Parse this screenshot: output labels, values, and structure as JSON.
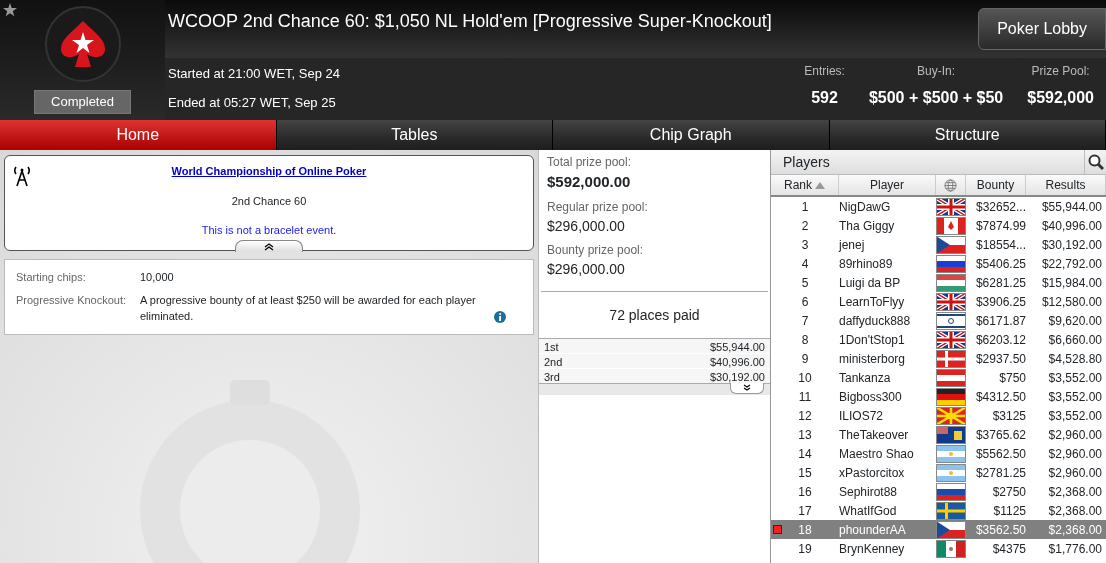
{
  "header": {
    "status": "Completed",
    "title": "WCOOP 2nd Chance 60: $1,050 NL Hold'em [Progressive Super-Knockout]",
    "started": "Started at 21:00 WET, Sep 24",
    "ended": "Ended at 05:27 WET, Sep 25",
    "lobby_button": "Poker Lobby",
    "stats": [
      {
        "label": "Entries:",
        "value": "592"
      },
      {
        "label": "Buy-In:",
        "value": "$500 + $500 + $50"
      },
      {
        "label": "Prize Pool:",
        "value": "$592,000"
      }
    ]
  },
  "tabs": [
    {
      "label": "Home",
      "selected": true
    },
    {
      "label": "Tables",
      "selected": false
    },
    {
      "label": "Chip Graph",
      "selected": false
    },
    {
      "label": "Structure",
      "selected": false
    }
  ],
  "info": {
    "link": "World Championship of Online Poker",
    "event": "2nd Chance 60",
    "note": "This is not a bracelet event."
  },
  "details": [
    {
      "label": "Starting chips:",
      "value": "10,000"
    },
    {
      "label": "Progressive Knockout:",
      "value": "A progressive bounty of at least $250 will be awarded for each player eliminated."
    }
  ],
  "prizes": {
    "pools": [
      {
        "label": "Total prize pool:",
        "value": "$592,000.00"
      },
      {
        "label": "Regular prize pool:",
        "value": "$296,000.00"
      },
      {
        "label": "Bounty prize pool:",
        "value": "$296,000.00"
      }
    ],
    "places": "72 places paid",
    "payouts": [
      {
        "place": "1st",
        "amount": "$55,944.00"
      },
      {
        "place": "2nd",
        "amount": "$40,996.00"
      },
      {
        "place": "3rd",
        "amount": "$30,192.00"
      }
    ]
  },
  "players": {
    "title": "Players",
    "columns": [
      "Rank",
      "Player",
      "Bounty",
      "Results"
    ],
    "rows": [
      {
        "rank": "1",
        "name": "NigDawG",
        "kind": "uk",
        "bounty": "$32652...",
        "result": "$55,944.00",
        "selected": false
      },
      {
        "rank": "2",
        "name": "Tha Giggy",
        "kind": "canada",
        "bounty": "$7874.99",
        "result": "$40,996.00",
        "selected": false
      },
      {
        "rank": "3",
        "name": "jenej",
        "kind": "czech",
        "bounty": "$18554...",
        "result": "$30,192.00",
        "selected": false
      },
      {
        "rank": "4",
        "name": "89rhino89",
        "kind": "russia",
        "bounty": "$5406.25",
        "result": "$22,792.00",
        "selected": false
      },
      {
        "rank": "5",
        "name": "Luigi da BP",
        "kind": "hungary",
        "bounty": "$6281.25",
        "result": "$15,984.00",
        "selected": false
      },
      {
        "rank": "6",
        "name": "LearnToFlyy",
        "kind": "uk",
        "bounty": "$3906.25",
        "result": "$12,580.00",
        "selected": false
      },
      {
        "rank": "7",
        "name": "daffyduck888",
        "kind": "israel",
        "bounty": "$6171.87",
        "result": "$9,620.00",
        "selected": false
      },
      {
        "rank": "8",
        "name": "1Don'tStop1",
        "kind": "uk",
        "bounty": "$6203.12",
        "result": "$6,660.00",
        "selected": false
      },
      {
        "rank": "9",
        "name": "ministerborg",
        "kind": "denmark",
        "bounty": "$2937.50",
        "result": "$4,528.80",
        "selected": false
      },
      {
        "rank": "10",
        "name": "Tankanza",
        "kind": "austria",
        "bounty": "$750",
        "result": "$3,552.00",
        "selected": false
      },
      {
        "rank": "11",
        "name": "Bigboss300",
        "kind": "germany",
        "bounty": "$4312.50",
        "result": "$3,552.00",
        "selected": false
      },
      {
        "rank": "12",
        "name": "ILIOS72",
        "kind": "macedonia",
        "bounty": "$3125",
        "result": "$3,552.00",
        "selected": false
      },
      {
        "rank": "13",
        "name": "TheTakeover",
        "kind": "caicos",
        "bounty": "$3765.62",
        "result": "$2,960.00",
        "selected": false
      },
      {
        "rank": "14",
        "name": "Maestro Shao",
        "kind": "argentina",
        "bounty": "$5562.50",
        "result": "$2,960.00",
        "selected": false
      },
      {
        "rank": "15",
        "name": "xPastorcitox",
        "kind": "argentina",
        "bounty": "$2781.25",
        "result": "$2,960.00",
        "selected": false
      },
      {
        "rank": "16",
        "name": "Sephirot88",
        "kind": "slovenia",
        "bounty": "$2750",
        "result": "$2,368.00",
        "selected": false
      },
      {
        "rank": "17",
        "name": "WhatIfGod",
        "kind": "sweden",
        "bounty": "$1125",
        "result": "$2,368.00",
        "selected": false
      },
      {
        "rank": "18",
        "name": "phounderAA",
        "kind": "czech",
        "bounty": "$3562.50",
        "result": "$2,368.00",
        "selected": true
      },
      {
        "rank": "19",
        "name": "BrynKenney",
        "kind": "mexico",
        "bounty": "$4375",
        "result": "$1,776.00",
        "selected": false
      }
    ]
  }
}
